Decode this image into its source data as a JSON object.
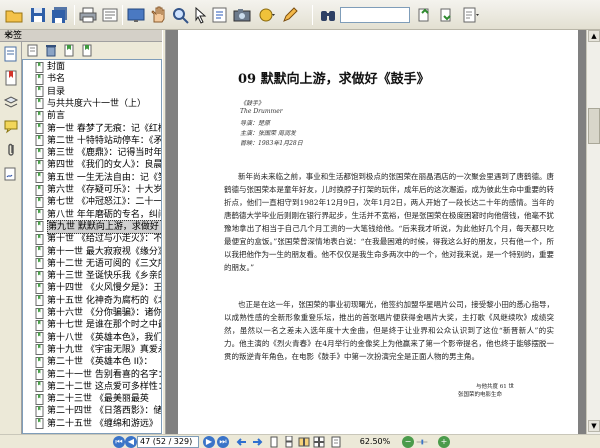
{
  "toolbar": {
    "search_value": ""
  },
  "sidebar": {
    "header_title": "书签",
    "close_glyph": "×",
    "bookmarks": [
      {
        "label": "封面"
      },
      {
        "label": "书名"
      },
      {
        "label": "目录"
      },
      {
        "label": "与共共度六十一世（上）"
      },
      {
        "label": "前言"
      },
      {
        "label": "第一世 春梦了无痕：记《红楼"
      },
      {
        "label": "第二世 十特特站动停车：《矛"
      },
      {
        "label": "第三世 《鹿鼎》：记得当时年"
      },
      {
        "label": "第四世 《我们的女人》：良晨"
      },
      {
        "label": "第五世 一生无法自由：记《笑"
      },
      {
        "label": "第六世 《存疑可乐》：十大岁"
      },
      {
        "label": "第七世 《冲冠怒江》：二十一"
      },
      {
        "label": "第八世 年年磨砺的专名，纠问"
      },
      {
        "label": "第九世 默默向上游，求做好《"
      },
      {
        "label": "第十世 《给过与小走火》：不"
      },
      {
        "label": "第十一世 最大寂寂视《缘分》"
      },
      {
        "label": "第十二世 无语可阅的《三文所"
      },
      {
        "label": "第十三世 圣诞快乐我《乡亲的"
      },
      {
        "label": "第十四世 《火风慢夕是》：王"
      },
      {
        "label": "第十五世 化神奇为腐朽的《北"
      },
      {
        "label": "第十六世 《分你骗骗》：诸你"
      },
      {
        "label": "第十七世 是谁在那个时之中最"
      },
      {
        "label": "第十八世 《英雄本色》，我们"
      },
      {
        "label": "第十九世 《宇宙无限》真爱永恒"
      },
      {
        "label": "第二十世 《英雄本色 II》："
      },
      {
        "label": "第二十一世 告别看喜的名字："
      },
      {
        "label": "第二十二世 这点爱可多样性："
      },
      {
        "label": "第二十三世 《最美丽最英"
      },
      {
        "label": "第二十四世 《日落西影》：储"
      },
      {
        "label": "第二十五世 《缠绵和游远》"
      }
    ],
    "selected_index": 13
  },
  "document": {
    "chapter_title": "09  默默向上游，求做好《鼓手》",
    "meta_lines": [
      "《鼓手》",
      "The Drummer",
      "导演：楚原",
      "主演：张国荣  周润发",
      "首映：1983年1月28日"
    ],
    "paragraphs": [
      "新年尚未来临之前，事业和生活都饱到极点的张国荣在丽晶酒店的一次聚会里遇到了唐鹤德。唐鹤德与张国荣本是童年好友，儿时换脖子打架的玩伴，成年后的这次邂逅，成为彼此生命中重要的转折点，他们一直相守到1982年12月9日，次年1月2日，两人开始了一段长达二十年的感情。当年的唐鹤德大学毕业后则刚在银行界起步，生活并不宽裕，但是张国荣在极度困窘时向他借钱，他毫不犹豫地拿出了相当于自己几个月工资的一大笔钱给他。“后来我才听说，为此他好几个月，每天都只吃最便宜的盒饭。”张国荣曾深情地表白说：“在我最困难的时候，得我这么好的朋友，只有他一个，所以我把他作为一生的朋友看。他不仅仅是我生命多两次中的一个，他对我来说，是一个特别的，重要的朋友。”",
      "也正是在这一年，张国荣的事业初现曙光，他签约加盟华星唱片公司，接受黎小田的悉心指导，以成熟性感的全新形象重登乐坛，推出的首张唱片便获得金唱片大奖，主打歌《风继续吹》成绩突然，虽然以一名之差未入选年度十大金曲，但是终于让业界和公众认识到了这位“新晋新人”的实力。他主演的《烈火青春》在4月举行的金像奖上为他赢来了第一个影帝提名，他也终于能够摆脱一贯的叛逆青年角色，在电影《鼓手》中第一次扮演完全是正面人物的男主角。"
    ],
    "footer_right": "与他共度 61 世",
    "footer_sub": "张国荣的电影生命"
  },
  "status": {
    "page_field": "47 (52 / 329)",
    "zoom": "62.50%"
  },
  "colors": {
    "accent": "#3b74c8",
    "chrome": "#ece9d8",
    "page_bg": "#ffffff",
    "doc_gray": "#808080"
  }
}
